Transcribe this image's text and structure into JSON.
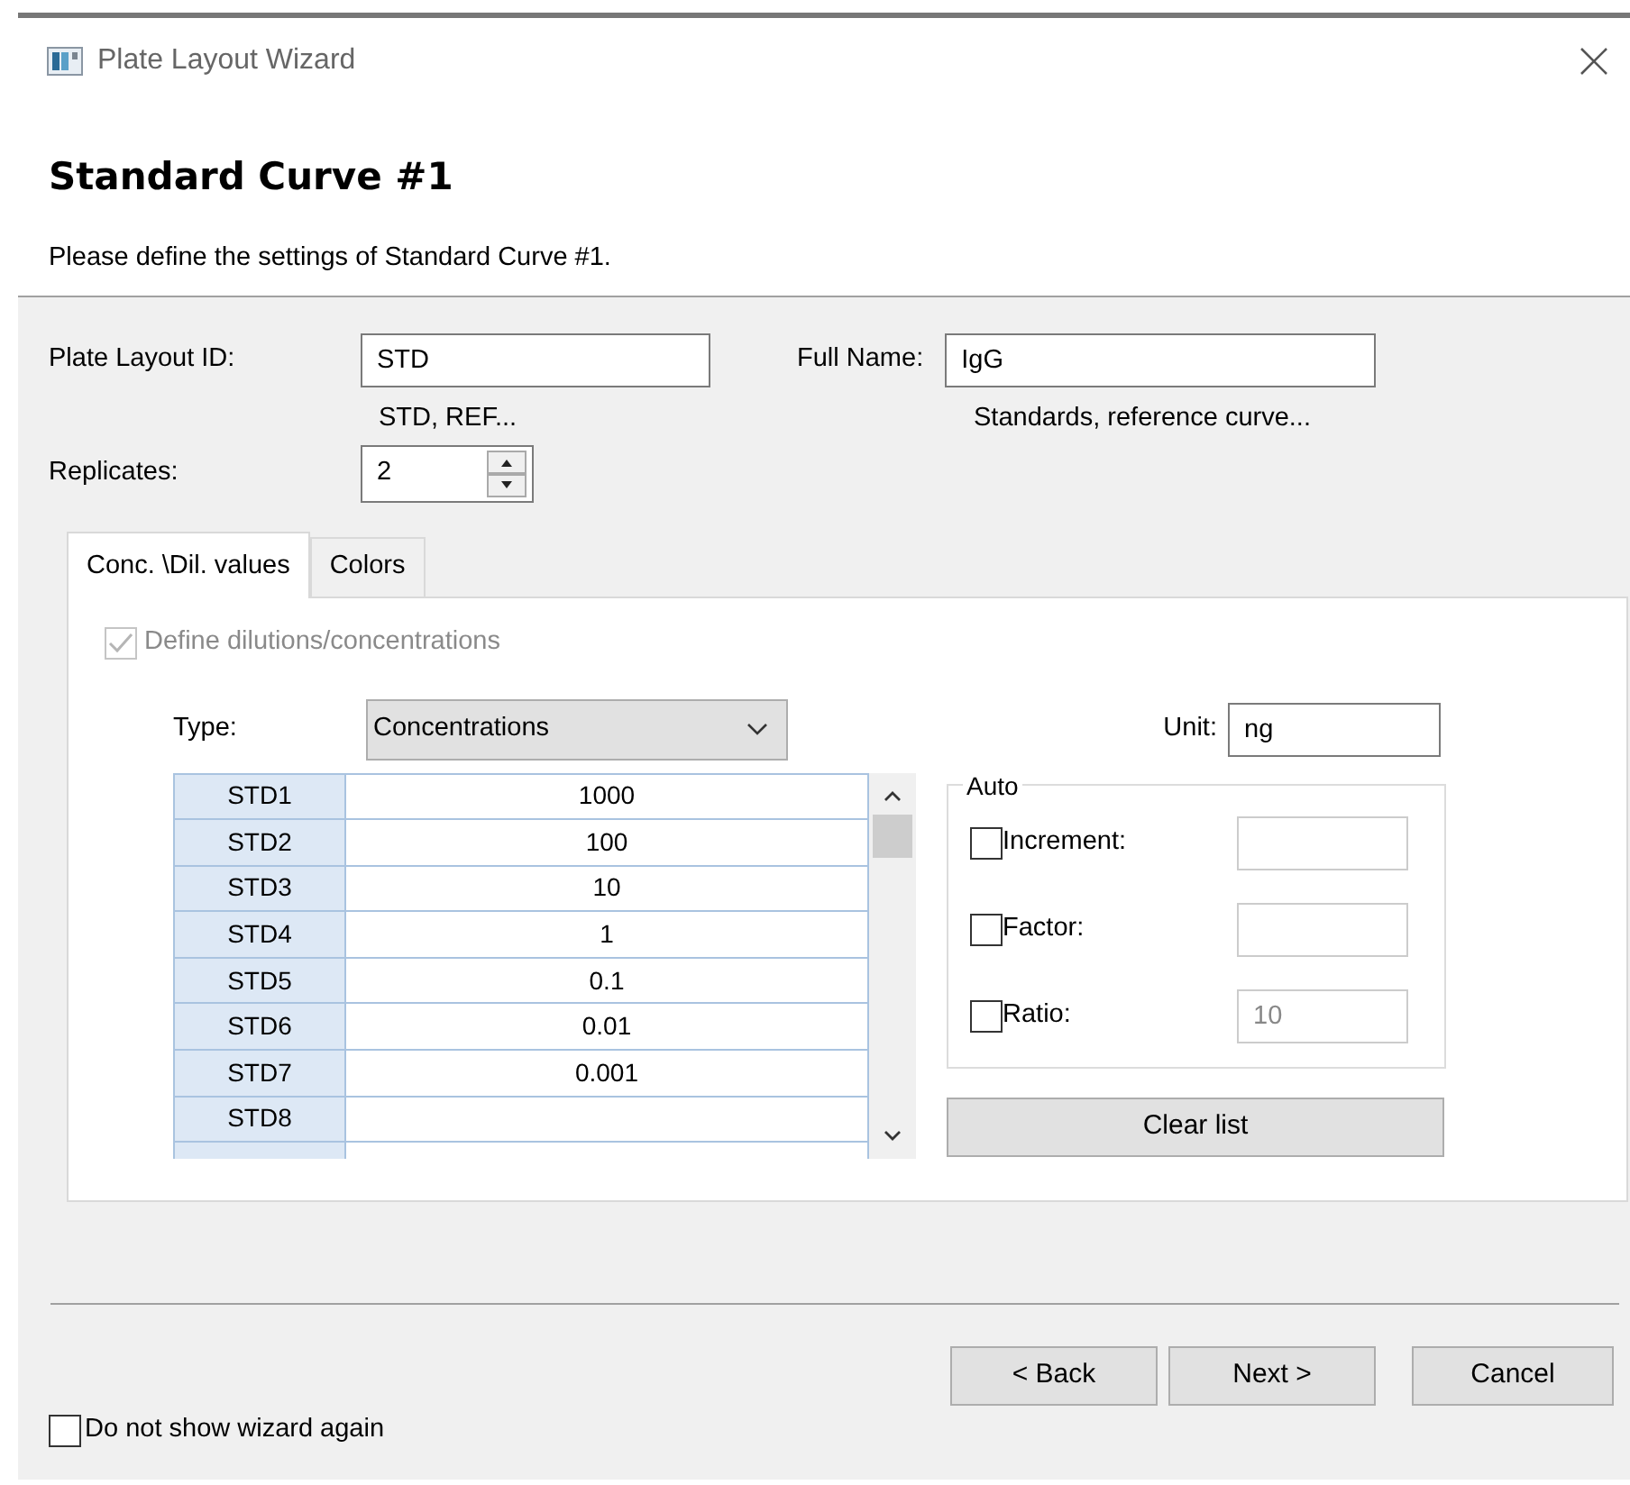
{
  "window": {
    "title": "Plate Layout Wizard"
  },
  "header": {
    "title": "Standard Curve #1",
    "subtitle": "Please define the settings of Standard Curve #1."
  },
  "plate_layout_id": {
    "label": "Plate Layout ID:",
    "value": "STD",
    "hint": "STD, REF..."
  },
  "full_name": {
    "label": "Full Name:",
    "value": "IgG",
    "hint": "Standards, reference curve..."
  },
  "replicates": {
    "label": "Replicates:",
    "value": "2"
  },
  "tabs": [
    {
      "label": "Conc. \\Dil. values",
      "selected": true
    },
    {
      "label": "Colors",
      "selected": false
    }
  ],
  "define_checkbox": {
    "label": "Define dilutions/concentrations",
    "checked": true,
    "disabled": true
  },
  "type": {
    "label": "Type:",
    "value": "Concentrations"
  },
  "unit": {
    "label": "Unit:",
    "value": "ng"
  },
  "table": {
    "rows": [
      {
        "name": "STD1",
        "value": "1000"
      },
      {
        "name": "STD2",
        "value": "100"
      },
      {
        "name": "STD3",
        "value": "10"
      },
      {
        "name": "STD4",
        "value": "1"
      },
      {
        "name": "STD5",
        "value": "0.1"
      },
      {
        "name": "STD6",
        "value": "0.01"
      },
      {
        "name": "STD7",
        "value": "0.001"
      },
      {
        "name": "STD8"
      }
    ]
  },
  "auto": {
    "title": "Auto",
    "options": [
      {
        "label": "Increment:",
        "checked": false
      },
      {
        "label": "Factor:",
        "checked": false
      },
      {
        "label": "Ratio:",
        "checked": false,
        "value": "10"
      }
    ]
  },
  "clear_button": "Clear list",
  "buttons": [
    "< Back",
    "Next >",
    "Cancel"
  ],
  "dont_show": {
    "label": "Do not show wizard again",
    "checked": false
  }
}
